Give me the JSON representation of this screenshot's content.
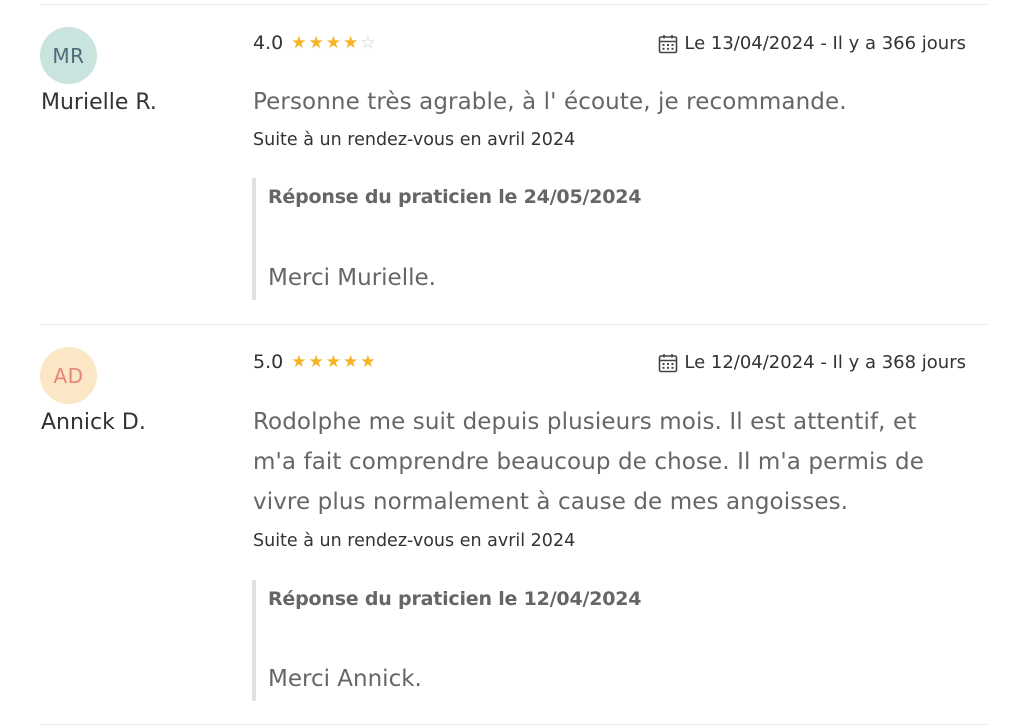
{
  "reviews": [
    {
      "initials": "MR",
      "avatar_bg": "#c9e3df",
      "avatar_fg": "#4c6a77",
      "author": "Murielle R.",
      "rating": "4.0",
      "stars": [
        "full",
        "full",
        "full",
        "full",
        "empty"
      ],
      "date_text": "Le 13/04/2024 - Il y a 366 jours",
      "comment": "Personne très agrable, à l' écoute, je recommande.",
      "visit": "Suite à un rendez-vous en avril 2024",
      "response_title": "Réponse du praticien le 24/05/2024",
      "response_text": "Merci Murielle."
    },
    {
      "initials": "AD",
      "avatar_bg": "#fbe7c5",
      "avatar_fg": "#e8857a",
      "author": "Annick D.",
      "rating": "5.0",
      "stars": [
        "full",
        "full",
        "full",
        "full",
        "full"
      ],
      "date_text": "Le 12/04/2024 - Il y a 368 jours",
      "comment": "Rodolphe me suit depuis plusieurs mois. Il est attentif, et m'a fait comprendre beaucoup de chose. Il m'a permis de vivre plus normalement à cause de mes angoisses.",
      "visit": "Suite à un rendez-vous en avril 2024",
      "response_title": "Réponse du praticien le 12/04/2024",
      "response_text": "Merci Annick."
    }
  ],
  "icons": {
    "date": "calendar-icon",
    "rating": "star-icon"
  },
  "colors": {
    "star": "#f5b325",
    "star_empty": "#c9c9c9",
    "divider": "#e6e6e6",
    "response_border": "#dde1e6"
  }
}
